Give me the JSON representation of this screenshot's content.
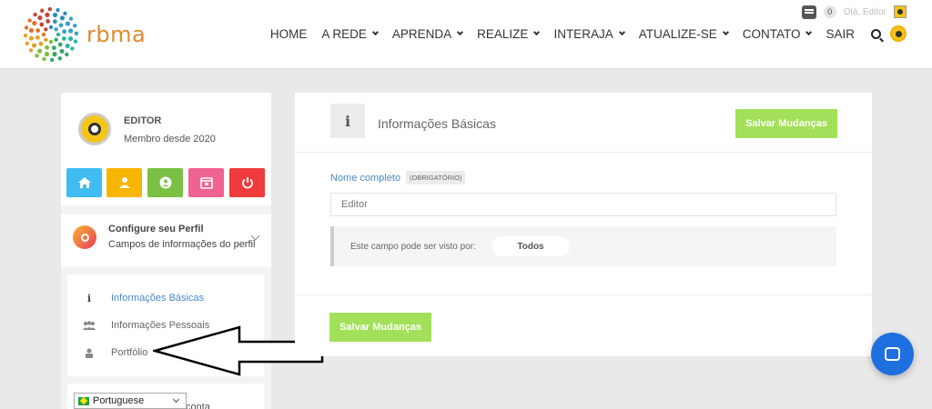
{
  "brand": {
    "name": "rbma"
  },
  "topbar": {
    "notification_count": "0",
    "greeting": "Olá, Editor"
  },
  "nav": {
    "items": [
      {
        "label": "HOME",
        "has_caret": false
      },
      {
        "label": "A REDE",
        "has_caret": true
      },
      {
        "label": "APRENDA",
        "has_caret": true
      },
      {
        "label": "REALIZE",
        "has_caret": true
      },
      {
        "label": "INTERAJA",
        "has_caret": true
      },
      {
        "label": "ATUALIZE-SE",
        "has_caret": true
      },
      {
        "label": "CONTATO",
        "has_caret": true
      },
      {
        "label": "SAIR",
        "has_caret": false
      }
    ]
  },
  "sidebar": {
    "profile": {
      "name": "EDITOR",
      "member_since": "Membro desde 2020"
    },
    "quick_buttons": [
      {
        "icon": "home-icon",
        "color": "#3fbdf0"
      },
      {
        "icon": "user-icon",
        "color": "#f7b500"
      },
      {
        "icon": "account-circle-icon",
        "color": "#7ac143"
      },
      {
        "icon": "calendar-icon",
        "color": "#f06292"
      },
      {
        "icon": "power-icon",
        "color": "#ef3b3b"
      }
    ],
    "config": {
      "title": "Configure seu Perfil",
      "subtitle": "Campos de informações do perfil"
    },
    "menu": [
      {
        "label": "Informações Básicas",
        "icon": "i",
        "active": true
      },
      {
        "label": "Informações Pessoais",
        "icon": "users",
        "active": false
      },
      {
        "label": "Portfólio",
        "icon": "user",
        "active": false
      }
    ],
    "account_label": "conta",
    "language": {
      "selected": "Portuguese"
    }
  },
  "main": {
    "title": "Informações Básicas",
    "save_label": "Salvar Mudanças",
    "field": {
      "label": "Nome completo",
      "required_badge": "(OBRIGATÓRIO)",
      "value": "Editor"
    },
    "visibility": {
      "label": "Este campo pode ser visto por:",
      "value": "Todos"
    }
  },
  "colors": {
    "accent_green": "#a2e059",
    "link_blue": "#4a8ac4",
    "chat_blue": "#1e6fe0"
  }
}
